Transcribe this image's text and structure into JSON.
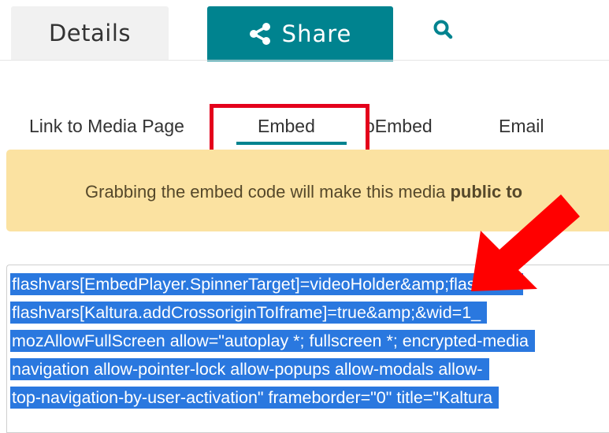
{
  "tabs": {
    "details_label": "Details",
    "share_label": "Share"
  },
  "share_subtabs": [
    {
      "label": "Link to Media Page"
    },
    {
      "label": "Embed",
      "active": true
    },
    {
      "label": "oEmbed"
    },
    {
      "label": "Email"
    }
  ],
  "warning": {
    "text": "Grabbing the embed code will make this media ",
    "bold_text": "public to"
  },
  "embed_code": {
    "lines": [
      "flashvars[EmbedPlayer.SpinnerTarget]=videoHolder&amp;flashvars",
      "flashvars[Kaltura.addCrossoriginToIframe]=true&amp;&wid=1_",
      "mozAllowFullScreen allow=\"autoplay *; fullscreen *; encrypted-media",
      "navigation allow-pointer-lock allow-popups allow-modals allow-",
      "top-navigation-by-user-activation\" frameborder=\"0\" title=\"Kaltura"
    ]
  },
  "colors": {
    "share_tab_bg": "#00838f",
    "highlight_red": "#e4001b",
    "warning_bg": "#fbe2a1",
    "selection_blue": "#2a78df"
  },
  "icons": {
    "share": "share-icon",
    "search": "search-icon",
    "annotation_arrow": "red-arrow-icon"
  }
}
